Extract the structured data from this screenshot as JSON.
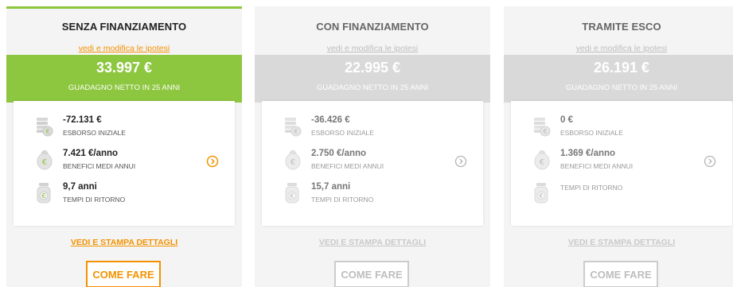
{
  "colors": {
    "accent_green": "#8dc63f",
    "accent_orange": "#f39200",
    "inactive_gray": "#d9d9d9"
  },
  "cards": [
    {
      "title": "SENZA FINANZIAMENTO",
      "hypothesis_link": "vedi e modifica le ipotesi",
      "net_gain_value": "33.997 €",
      "net_gain_label": "GUADAGNO NETTO IN 25 ANNI",
      "initial_outlay_value": "-72.131 €",
      "initial_outlay_label": "ESBORSO INIZIALE",
      "annual_benefit_value": "7.421 €/anno",
      "annual_benefit_label": "BENEFICI MEDI ANNUI",
      "payback_value": "9,7 anni",
      "payback_label": "TEMPI DI RITORNO",
      "print_link": "VEDI E STAMPA DETTAGLI",
      "how_button": "COME FARE",
      "selected": true
    },
    {
      "title": "CON FINANZIAMENTO",
      "hypothesis_link": "vedi e modifica le ipotesi",
      "net_gain_value": "22.995 €",
      "net_gain_label": "GUADAGNO NETTO IN 25 ANNI",
      "initial_outlay_value": "-36.426 €",
      "initial_outlay_label": "ESBORSO INIZIALE",
      "annual_benefit_value": "2.750 €/anno",
      "annual_benefit_label": "BENEFICI MEDI ANNUI",
      "payback_value": "15,7 anni",
      "payback_label": "TEMPI DI RITORNO",
      "print_link": "VEDI E STAMPA DETTAGLI",
      "how_button": "COME FARE",
      "selected": false
    },
    {
      "title": "TRAMITE ESCO",
      "hypothesis_link": "vedi e modifica le ipotesi",
      "net_gain_value": "26.191 €",
      "net_gain_label": "GUADAGNO NETTO IN 25 ANNI",
      "initial_outlay_value": "0 €",
      "initial_outlay_label": "ESBORSO INIZIALE",
      "annual_benefit_value": "1.369 €/anno",
      "annual_benefit_label": "BENEFICI MEDI ANNUI",
      "payback_value": "",
      "payback_label": "TEMPI DI RITORNO",
      "print_link": "VEDI E STAMPA DETTAGLI",
      "how_button": "COME FARE",
      "selected": false
    }
  ],
  "icons": [
    "money-stack-icon",
    "piggy-bank-icon",
    "coin-jar-icon",
    "chevron-right-circle-icon"
  ]
}
